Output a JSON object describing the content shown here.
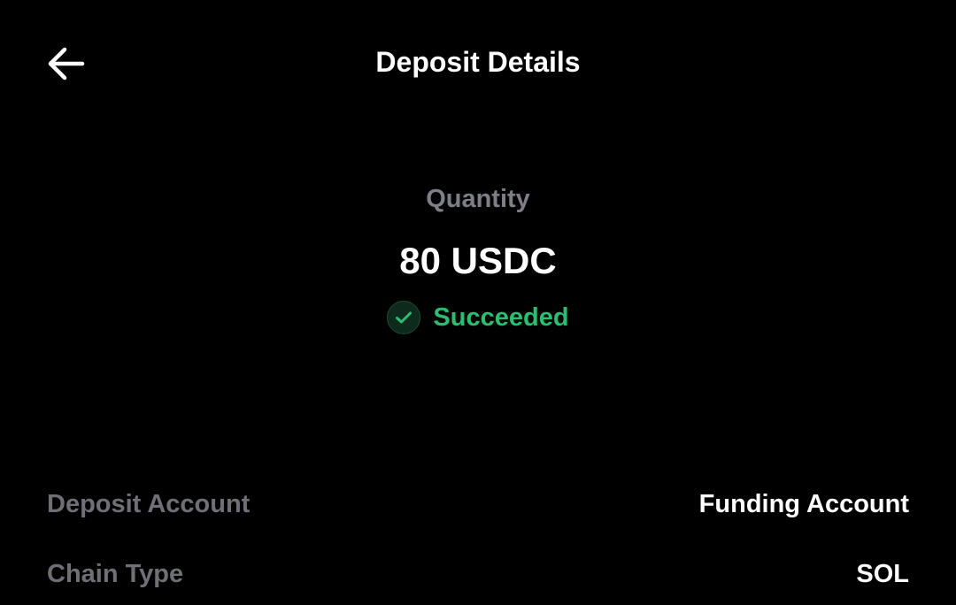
{
  "header": {
    "title": "Deposit Details",
    "back_icon": "arrow-left-icon"
  },
  "summary": {
    "quantity_label": "Quantity",
    "quantity_value": "80 USDC",
    "status_text": "Succeeded",
    "status_icon": "check-circle-icon",
    "status_color": "#2dbd72"
  },
  "details": [
    {
      "label": "Deposit Account",
      "value": "Funding Account"
    },
    {
      "label": "Chain Type",
      "value": "SOL"
    }
  ],
  "colors": {
    "background": "#000000",
    "label_gray": "#7d7f86",
    "success_green": "#2dbd72"
  }
}
